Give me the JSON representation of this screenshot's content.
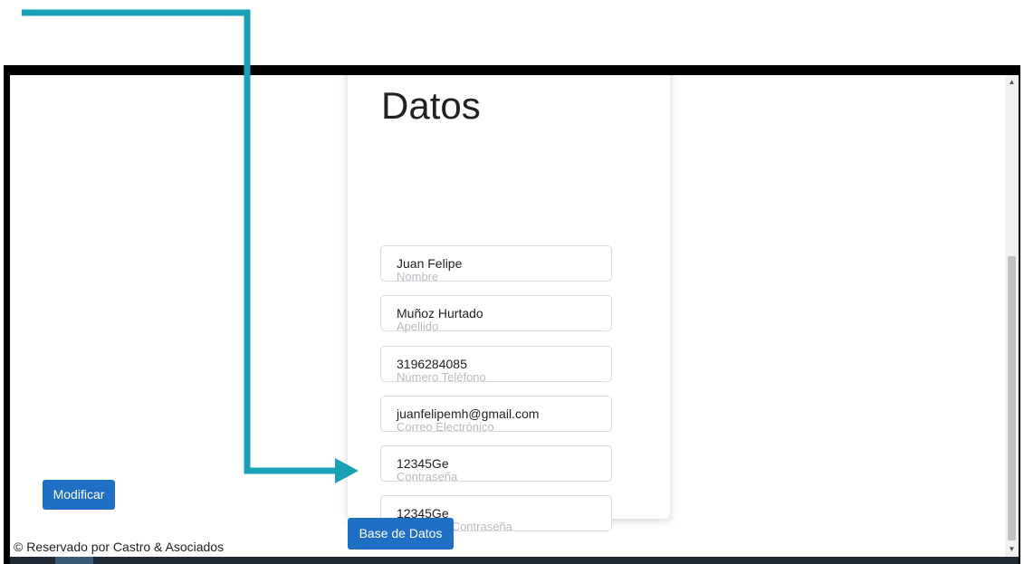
{
  "card": {
    "title": "Datos",
    "fields": [
      {
        "value": "Juan Felipe",
        "label": "Nombre"
      },
      {
        "value": "Muñoz Hurtado",
        "label": "Apellido"
      },
      {
        "value": "3196284085",
        "label": "Número Teléfono"
      },
      {
        "value": "juanfelipemh@gmail.com",
        "label": "Correo Electrónico"
      },
      {
        "value": "12345Ge",
        "label": "Contraseña"
      },
      {
        "value": "12345Ge",
        "label": "Confirmar Contraseña"
      }
    ],
    "submit_label": "Modificar"
  },
  "database_button_label": "Base de Datos",
  "footer": {
    "text": "© Reservado por Castro & Asociados"
  },
  "scrollbar": {
    "up_arrow": "▲",
    "down_arrow": "▼"
  },
  "colors": {
    "primary_button": "#1f6fc4",
    "annotation_arrow": "#1aa0b4"
  },
  "annotation": {
    "target": "submit-button"
  }
}
